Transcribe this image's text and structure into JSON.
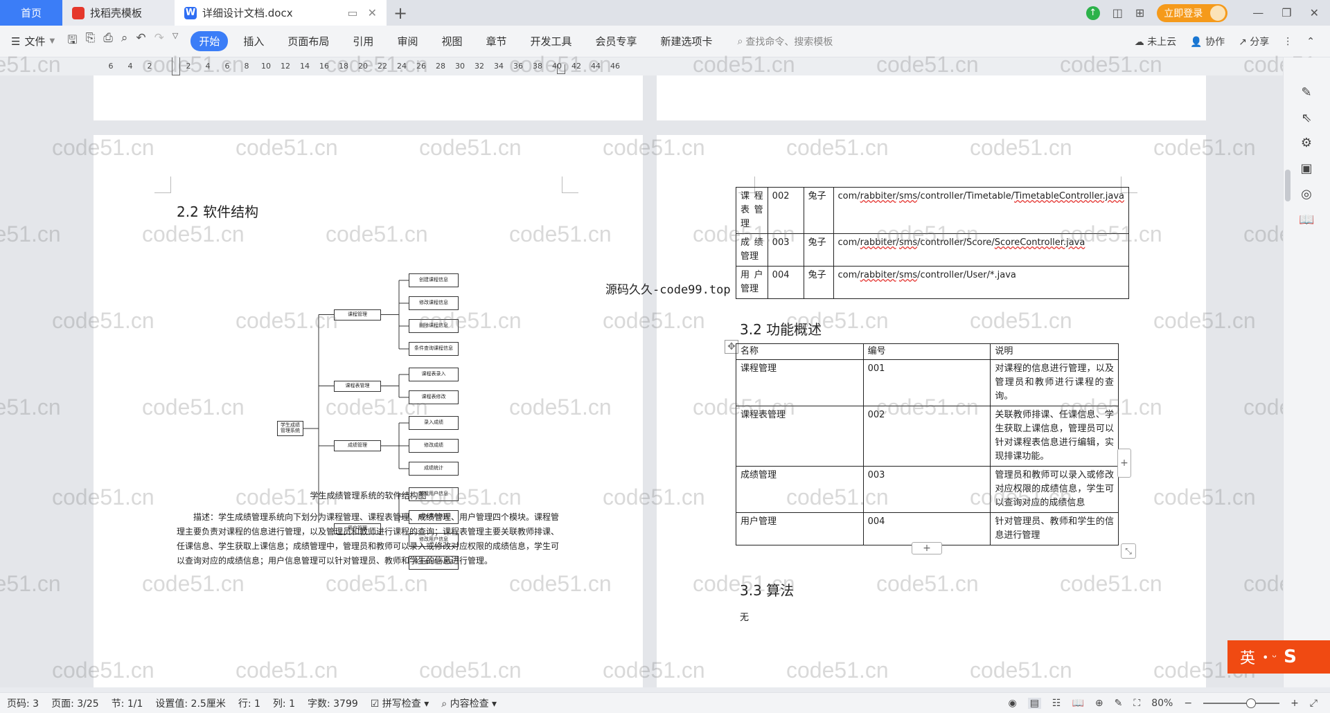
{
  "tabs": {
    "home": "首页",
    "template": "找稻壳模板",
    "document": "详细设计文档.docx",
    "new_tab": "+",
    "login": "立即登录"
  },
  "ribbon": {
    "file": "文件",
    "tabs": [
      "开始",
      "插入",
      "页面布局",
      "引用",
      "审阅",
      "视图",
      "章节",
      "开发工具",
      "会员专享",
      "新建选项卡"
    ],
    "active_tab": "开始",
    "search_placeholder": "查找命令、搜索模板",
    "cloud": "未上云",
    "collab": "协作",
    "share": "分享"
  },
  "ruler": {
    "numbers": [
      "6",
      "4",
      "2",
      "",
      "2",
      "4",
      "6",
      "8",
      "10",
      "12",
      "14",
      "16",
      "18",
      "20",
      "22",
      "24",
      "26",
      "28",
      "30",
      "32",
      "34",
      "36",
      "38",
      "40",
      "42",
      "44",
      "46"
    ]
  },
  "left_page": {
    "section_title": "2.2  软件结构",
    "root": "学生成绩管理系统",
    "modules": [
      {
        "name": "课程管理",
        "children": [
          "创建课程信息",
          "修改课程信息",
          "删除课程信息",
          "条件查询课程信息"
        ]
      },
      {
        "name": "课程表管理",
        "children": [
          "课程表录入",
          "课程表修改"
        ]
      },
      {
        "name": "成绩管理",
        "children": [
          "录入成绩",
          "修改成绩",
          "成绩统计"
        ]
      },
      {
        "name": "用户管理",
        "children": [
          "新增用户信息",
          "删除用户信息",
          "修改用户信息",
          "条件查询用户信息"
        ]
      }
    ],
    "caption": "学生成绩管理系统的软件结构图",
    "description": "描述：学生成绩管理系统向下划分为课程管理、课程表管理、成绩管理、用户管理四个模块。课程管理主要负责对课程的信息进行管理，以及管理员和教师进行课程的查询；课程表管理主要关联教师排课、任课信息、学生获取上课信息；成绩管理中，管理员和教师可以录入或修改对应权限的成绩信息，学生可以查询对应的成绩信息；用户信息管理可以针对管理员、教师和学生的信息进行管理。"
  },
  "right_page": {
    "table1": [
      [
        "课程表管理",
        "002",
        "兔子",
        "com/rabbiter/sms/controller/Timetable/TimetableController.java"
      ],
      [
        "成绩管理",
        "003",
        "兔子",
        "com/rabbiter/sms/controller/Score/ScoreController.java"
      ],
      [
        "用户管理",
        "004",
        "兔子",
        "com/rabbiter/sms/controller/User/*.java"
      ]
    ],
    "section_32": "3.2  功能概述",
    "table2_headers": [
      "名称",
      "编号",
      "说明"
    ],
    "table2": [
      [
        "课程管理",
        "001",
        "对课程的信息进行管理，以及管理员和教师进行课程的查询。"
      ],
      [
        "课程表管理",
        "002",
        "关联教师排课、任课信息、学生获取上课信息，管理员可以针对课程表信息进行编辑，实现排课功能。"
      ],
      [
        "成绩管理",
        "003",
        "管理员和教师可以录入或修改对应权限的成绩信息，学生可以查询对应的成绩信息"
      ],
      [
        "用户管理",
        "004",
        "针对管理员、教师和学生的信息进行管理"
      ]
    ],
    "section_33": "3.3  算法",
    "algo_text": "无"
  },
  "overlay_text": "源码久久-code99.top",
  "watermark": "code51.cn",
  "ime": "英",
  "status": {
    "page_code": "页码: 3",
    "pages": "页面: 3/25",
    "section": "节: 1/1",
    "setting": "设置值: 2.5厘米",
    "row": "行: 1",
    "col": "列: 1",
    "words": "字数: 3799",
    "spell": "拼写检查",
    "content": "内容检查",
    "zoom": "80%"
  }
}
